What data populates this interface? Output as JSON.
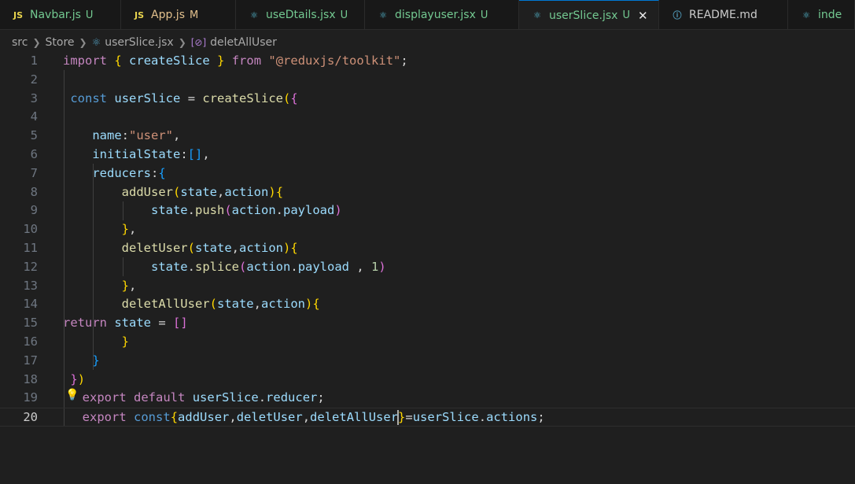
{
  "tabs": [
    {
      "icon": "JS",
      "label": "Navbar.js",
      "status": "U",
      "color": "#73c991",
      "icon_color": "#e8d44d"
    },
    {
      "icon": "JS",
      "label": "App.js",
      "status": "M",
      "color": "#e2c08d",
      "icon_color": "#e8d44d"
    },
    {
      "icon": "⚛",
      "label": "useDtails.jsx",
      "status": "U",
      "color": "#73c991",
      "icon_color": "#58c4dc"
    },
    {
      "icon": "⚛",
      "label": "displayuser.jsx",
      "status": "U",
      "color": "#73c991",
      "icon_color": "#58c4dc"
    },
    {
      "icon": "⚛",
      "label": "userSlice.jsx",
      "status": "U",
      "color": "#73c991",
      "icon_color": "#58c4dc",
      "active": true,
      "close": "✕"
    },
    {
      "icon": "ⓘ",
      "label": "README.md",
      "status": "",
      "color": "#cccccc",
      "icon_color": "#519aba"
    },
    {
      "icon": "⚛",
      "label": "inde",
      "status": "",
      "color": "#73c991",
      "icon_color": "#58c4dc"
    }
  ],
  "breadcrumb": {
    "items": [
      "src",
      "Store",
      "userSlice.jsx",
      "deletAllUser"
    ],
    "fn_icon": "[⊘]"
  },
  "editor": {
    "current_line": 20,
    "lines": [
      {
        "n": "1",
        "tokens": [
          [
            "kw",
            "import"
          ],
          [
            "punc",
            " "
          ],
          [
            "b1",
            "{"
          ],
          [
            "punc",
            " "
          ],
          [
            "var",
            "createSlice"
          ],
          [
            "punc",
            " "
          ],
          [
            "b1",
            "}"
          ],
          [
            "punc",
            " "
          ],
          [
            "kw",
            "from"
          ],
          [
            "punc",
            " "
          ],
          [
            "str",
            "\"@reduxjs/toolkit\""
          ],
          [
            "punc",
            ";"
          ]
        ]
      },
      {
        "n": "2",
        "tokens": []
      },
      {
        "n": "3",
        "tokens": [
          [
            "punc",
            " "
          ],
          [
            "kwb",
            "const"
          ],
          [
            "punc",
            " "
          ],
          [
            "var",
            "userSlice"
          ],
          [
            "punc",
            " = "
          ],
          [
            "fn",
            "createSlice"
          ],
          [
            "b1",
            "("
          ],
          [
            "b2",
            "{"
          ]
        ]
      },
      {
        "n": "4",
        "tokens": []
      },
      {
        "n": "5",
        "tokens": [
          [
            "punc",
            "    "
          ],
          [
            "var",
            "name"
          ],
          [
            "punc",
            ":"
          ],
          [
            "str",
            "\"user\""
          ],
          [
            "punc",
            ","
          ]
        ]
      },
      {
        "n": "6",
        "tokens": [
          [
            "punc",
            "    "
          ],
          [
            "var",
            "initialState"
          ],
          [
            "punc",
            ":"
          ],
          [
            "b3",
            "[]"
          ],
          [
            "punc",
            ","
          ]
        ]
      },
      {
        "n": "7",
        "tokens": [
          [
            "punc",
            "    "
          ],
          [
            "var",
            "reducers"
          ],
          [
            "punc",
            ":"
          ],
          [
            "b3",
            "{"
          ]
        ]
      },
      {
        "n": "8",
        "tokens": [
          [
            "punc",
            "        "
          ],
          [
            "fn",
            "addUser"
          ],
          [
            "b1",
            "("
          ],
          [
            "var",
            "state"
          ],
          [
            "punc",
            ","
          ],
          [
            "var",
            "action"
          ],
          [
            "b1",
            ")"
          ],
          [
            "b1",
            "{"
          ]
        ]
      },
      {
        "n": "9",
        "tokens": [
          [
            "punc",
            "            "
          ],
          [
            "var",
            "state"
          ],
          [
            "punc",
            "."
          ],
          [
            "fn",
            "push"
          ],
          [
            "b2",
            "("
          ],
          [
            "var",
            "action"
          ],
          [
            "punc",
            "."
          ],
          [
            "var",
            "payload"
          ],
          [
            "b2",
            ")"
          ]
        ]
      },
      {
        "n": "10",
        "tokens": [
          [
            "punc",
            "        "
          ],
          [
            "b1",
            "}"
          ],
          [
            "punc",
            ","
          ]
        ]
      },
      {
        "n": "11",
        "tokens": [
          [
            "punc",
            "        "
          ],
          [
            "fn",
            "deletUser"
          ],
          [
            "b1",
            "("
          ],
          [
            "var",
            "state"
          ],
          [
            "punc",
            ","
          ],
          [
            "var",
            "action"
          ],
          [
            "b1",
            ")"
          ],
          [
            "b1",
            "{"
          ]
        ]
      },
      {
        "n": "12",
        "tokens": [
          [
            "punc",
            "            "
          ],
          [
            "var",
            "state"
          ],
          [
            "punc",
            "."
          ],
          [
            "fn",
            "splice"
          ],
          [
            "b2",
            "("
          ],
          [
            "var",
            "action"
          ],
          [
            "punc",
            "."
          ],
          [
            "var",
            "payload"
          ],
          [
            "punc",
            " , "
          ],
          [
            "num",
            "1"
          ],
          [
            "b2",
            ")"
          ]
        ]
      },
      {
        "n": "13",
        "tokens": [
          [
            "punc",
            "        "
          ],
          [
            "b1",
            "}"
          ],
          [
            "punc",
            ","
          ]
        ]
      },
      {
        "n": "14",
        "tokens": [
          [
            "punc",
            "        "
          ],
          [
            "fn",
            "deletAllUser"
          ],
          [
            "b1",
            "("
          ],
          [
            "var",
            "state"
          ],
          [
            "punc",
            ","
          ],
          [
            "var",
            "action"
          ],
          [
            "b1",
            ")"
          ],
          [
            "b1",
            "{"
          ]
        ]
      },
      {
        "n": "15",
        "tokens": [
          [
            "kw",
            "return"
          ],
          [
            "punc",
            " "
          ],
          [
            "var",
            "state"
          ],
          [
            "punc",
            " = "
          ],
          [
            "b2",
            "[]"
          ]
        ]
      },
      {
        "n": "16",
        "tokens": [
          [
            "punc",
            "        "
          ],
          [
            "b1",
            "}"
          ]
        ]
      },
      {
        "n": "17",
        "tokens": [
          [
            "punc",
            "    "
          ],
          [
            "b3",
            "}"
          ]
        ]
      },
      {
        "n": "18",
        "tokens": [
          [
            "punc",
            " "
          ],
          [
            "b2",
            "}"
          ],
          [
            "b1",
            ")"
          ]
        ]
      },
      {
        "n": "19",
        "tokens": [
          [
            "punc",
            "  "
          ],
          [
            "kw",
            "export"
          ],
          [
            "punc",
            " "
          ],
          [
            "kw",
            "default"
          ],
          [
            "punc",
            " "
          ],
          [
            "var",
            "userSlice"
          ],
          [
            "punc",
            "."
          ],
          [
            "var",
            "reducer"
          ],
          [
            "punc",
            ";"
          ]
        ]
      },
      {
        "n": "20",
        "tokens": [
          [
            "punc",
            "  "
          ],
          [
            "kw",
            "export"
          ],
          [
            "punc",
            " "
          ],
          [
            "kwb",
            "const"
          ],
          [
            "b1",
            "{"
          ],
          [
            "var",
            "addUser"
          ],
          [
            "punc",
            ","
          ],
          [
            "var",
            "deletUser"
          ],
          [
            "punc",
            ","
          ],
          [
            "var",
            "deletAllUser"
          ],
          [
            "cursor",
            ""
          ],
          [
            "b1",
            "}"
          ],
          [
            "punc",
            "="
          ],
          [
            "var",
            "userSlice"
          ],
          [
            "punc",
            "."
          ],
          [
            "var",
            "actions"
          ],
          [
            "punc",
            ";"
          ]
        ]
      }
    ]
  },
  "lightbulb_icon": "💡"
}
